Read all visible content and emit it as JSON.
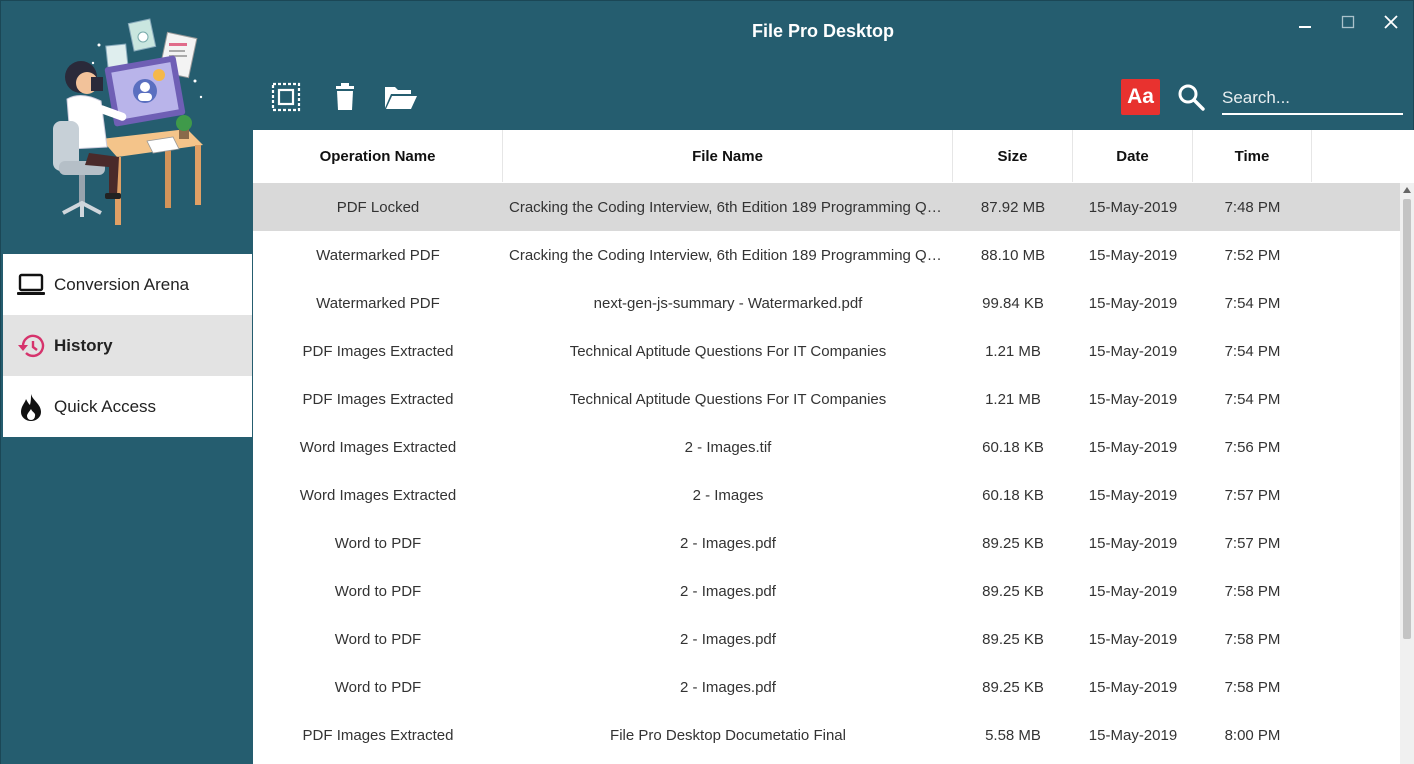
{
  "window": {
    "title": "File Pro Desktop",
    "controls": {
      "minimize": "minimize",
      "maximize": "maximize",
      "close": "close"
    }
  },
  "sidebar": {
    "items": [
      {
        "label": "Conversion Arena",
        "icon": "laptop-icon",
        "active": false
      },
      {
        "label": "History",
        "icon": "history-icon",
        "active": true
      },
      {
        "label": "Quick Access",
        "icon": "flame-icon",
        "active": false
      }
    ]
  },
  "toolbar": {
    "select_all_icon": "select-all-icon",
    "delete_icon": "trash-icon",
    "open_folder_icon": "folder-open-icon",
    "font_button_label": "Aa",
    "search_placeholder": "Search..."
  },
  "colors": {
    "primary": "#255d6f",
    "accent_red": "#e8322f",
    "selected_row": "#d9d9d9",
    "history_icon": "#d6336c"
  },
  "table": {
    "columns": [
      "Operation Name",
      "File Name",
      "Size",
      "Date",
      "Time"
    ],
    "selected_row": 0,
    "rows": [
      [
        "PDF Locked",
        "Cracking the Coding Interview, 6th Edition 189 Programming Qu...",
        "87.92 MB",
        "15-May-2019",
        "7:48 PM"
      ],
      [
        "Watermarked PDF",
        "Cracking the Coding Interview, 6th Edition 189 Programming Qu...",
        "88.10 MB",
        "15-May-2019",
        "7:52 PM"
      ],
      [
        "Watermarked PDF",
        "next-gen-js-summary - Watermarked.pdf",
        "99.84 KB",
        "15-May-2019",
        "7:54 PM"
      ],
      [
        "PDF Images Extracted",
        "Technical Aptitude Questions For IT Companies",
        "1.21 MB",
        "15-May-2019",
        "7:54 PM"
      ],
      [
        "PDF Images Extracted",
        "Technical Aptitude Questions For IT Companies",
        "1.21 MB",
        "15-May-2019",
        "7:54 PM"
      ],
      [
        "Word Images Extracted",
        "2 - Images.tif",
        "60.18 KB",
        "15-May-2019",
        "7:56 PM"
      ],
      [
        "Word Images Extracted",
        "2 - Images",
        "60.18 KB",
        "15-May-2019",
        "7:57 PM"
      ],
      [
        "Word to PDF",
        "2 - Images.pdf",
        "89.25 KB",
        "15-May-2019",
        "7:57 PM"
      ],
      [
        "Word to PDF",
        "2 - Images.pdf",
        "89.25 KB",
        "15-May-2019",
        "7:58 PM"
      ],
      [
        "Word to PDF",
        "2 - Images.pdf",
        "89.25 KB",
        "15-May-2019",
        "7:58 PM"
      ],
      [
        "Word to PDF",
        "2 - Images.pdf",
        "89.25 KB",
        "15-May-2019",
        "7:58 PM"
      ],
      [
        "PDF Images Extracted",
        "File Pro Desktop Documetatio Final",
        "5.58 MB",
        "15-May-2019",
        "8:00 PM"
      ]
    ]
  }
}
